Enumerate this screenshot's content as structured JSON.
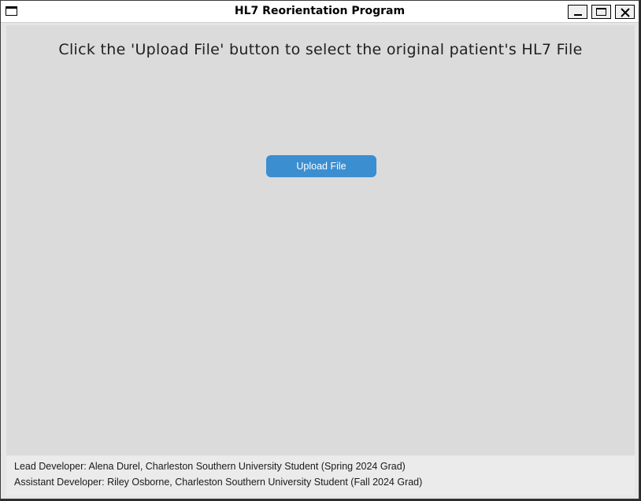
{
  "window": {
    "title": "HL7 Reorientation Program",
    "controls": [
      "minimize",
      "maximize",
      "close"
    ]
  },
  "main": {
    "instruction": "Click the 'Upload File' button to select the original patient's HL7 File",
    "upload_button_label": "Upload File"
  },
  "footer": {
    "lead_developer": "Lead Developer: Alena Durel, Charleston Southern University Student (Spring 2024 Grad)",
    "assistant_developer": "Assistant Developer: Riley Osborne, Charleston Southern University Student (Fall 2024 Grad)"
  },
  "colors": {
    "accent": "#3b8ed0",
    "background": "#dbdbdb",
    "footer_background": "#ebebeb"
  }
}
